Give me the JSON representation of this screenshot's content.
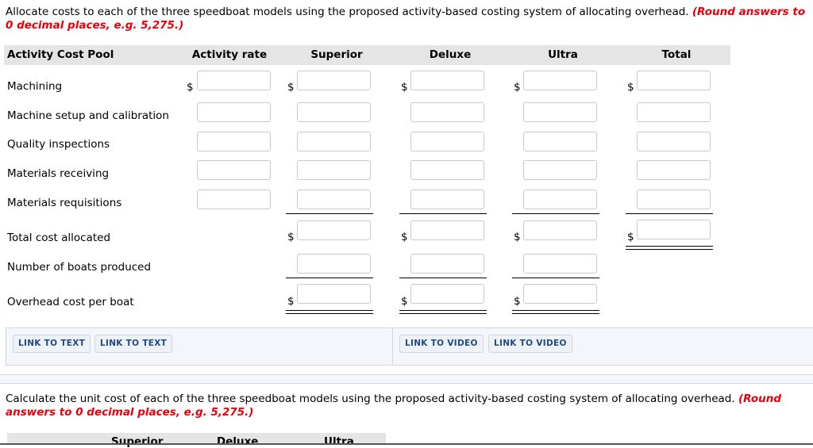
{
  "part1": {
    "instruction": "Allocate costs to each of the three speedboat models using the proposed activity-based costing system of allocating overhead.",
    "rounding_note": "(Round answers to 0 decimal places, e.g. 5,275.)",
    "headers": {
      "pool": "Activity Cost Pool",
      "rate": "Activity rate",
      "superior": "Superior",
      "deluxe": "Deluxe",
      "ultra": "Ultra",
      "total": "Total"
    },
    "rows": [
      {
        "label": "Machining"
      },
      {
        "label": "Machine setup and calibration"
      },
      {
        "label": "Quality inspections"
      },
      {
        "label": "Materials receiving"
      },
      {
        "label": "Materials requisitions"
      },
      {
        "label": "Total cost allocated"
      },
      {
        "label": "Number of boats produced"
      },
      {
        "label": "Overhead cost per boat"
      }
    ],
    "currency_symbol": "$",
    "inputs": {
      "value": ""
    }
  },
  "links": {
    "text_1": "LINK TO TEXT",
    "text_2": "LINK TO TEXT",
    "video_1": "LINK TO VIDEO",
    "video_2": "LINK TO VIDEO"
  },
  "part2": {
    "instruction": "Calculate the unit cost of each of the three speedboat models using the proposed activity-based costing system of allocating overhead.",
    "rounding_note": "(Round answers to 0 decimal places, e.g. 5,275.)",
    "headers": {
      "superior": "Superior",
      "deluxe": "Deluxe",
      "ultra": "Ultra"
    }
  },
  "colors": {
    "accent_red": "#e8000b",
    "link_text": "#1f4a85",
    "header_bg": "#e5e5e5"
  }
}
